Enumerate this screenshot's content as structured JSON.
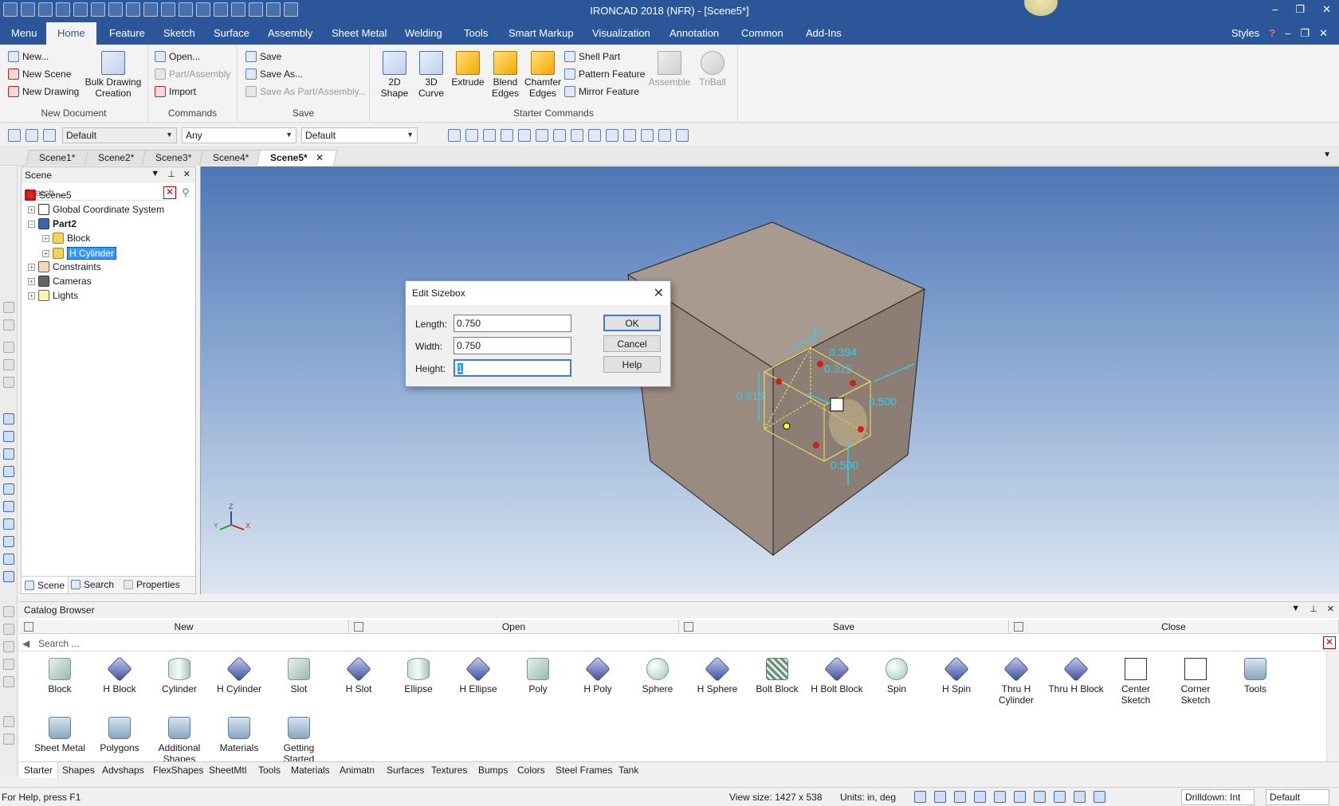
{
  "window": {
    "title": "IRONCAD 2018 (NFR) - [Scene5*]",
    "controls": [
      "–",
      "❐",
      "✕"
    ]
  },
  "menu": {
    "tabs": [
      "Menu",
      "Home",
      "Feature",
      "Sketch",
      "Surface",
      "Assembly",
      "Sheet Metal",
      "Welding",
      "Tools",
      "Smart Markup",
      "Visualization",
      "Annotation",
      "Common",
      "Add-Ins"
    ],
    "active": "Home",
    "styles_label": "Styles",
    "right_controls": [
      "?",
      "–",
      "❐",
      "✕"
    ]
  },
  "ribbon": {
    "new_document": {
      "label": "New Document",
      "new": "New...",
      "new_scene": "New Scene",
      "new_drawing": "New Drawing",
      "bulk_line1": "Bulk Drawing",
      "bulk_line2": "Creation"
    },
    "commands": {
      "label": "Commands",
      "open": "Open...",
      "part_assembly": "Part/Assembly",
      "import": "Import"
    },
    "save": {
      "label": "Save",
      "save": "Save",
      "save_as": "Save As...",
      "save_as_part": "Save As Part/Assembly..."
    },
    "starter": {
      "label": "Starter Commands",
      "shape_2d_l1": "2D",
      "shape_2d_l2": "Shape",
      "curve_3d_l1": "3D",
      "curve_3d_l2": "Curve",
      "extrude": "Extrude",
      "blend_l1": "Blend",
      "blend_l2": "Edges",
      "chamfer_l1": "Chamfer",
      "chamfer_l2": "Edges",
      "shell_part": "Shell Part",
      "pattern_feature": "Pattern Feature",
      "mirror_feature": "Mirror Feature",
      "assemble": "Assemble",
      "triball": "TriBall"
    }
  },
  "toolbar": {
    "style_combo": "Default",
    "filter_combo": "Any",
    "render_combo": "Default"
  },
  "scene_tabs": [
    "Scene1*",
    "Scene2*",
    "Scene3*",
    "Scene4*",
    "Scene5*"
  ],
  "scene_tabs_active": "Scene5*",
  "scene_panel": {
    "title": "Scene",
    "search_placeholder": "Search ...",
    "tree": {
      "root": "Scene5",
      "gcs": "Global Coordinate System",
      "part": "Part2",
      "block": "Block",
      "cylinder": "H Cylinder",
      "constraints": "Constraints",
      "cameras": "Cameras",
      "lights": "Lights"
    },
    "bottom_tabs": [
      "Scene",
      "Search",
      "Properties"
    ]
  },
  "viewport": {
    "dims": {
      "d1": "0.394",
      "d2": "0.315",
      "d3": "0.815",
      "d4": "0.500",
      "d5": "0.500"
    },
    "axes": {
      "x": "X",
      "y": "Y",
      "z": "Z"
    }
  },
  "dialog": {
    "title": "Edit Sizebox",
    "length_label": "Length:",
    "length_value": "0.750",
    "width_label": "Width:",
    "width_value": "0.750",
    "height_label": "Height:",
    "height_value": "1",
    "ok": "OK",
    "cancel": "Cancel",
    "help": "Help"
  },
  "catalog": {
    "title": "Catalog Browser",
    "actions": [
      "New",
      "Open",
      "Save",
      "Close"
    ],
    "search_placeholder": "Search ...",
    "items_row1": [
      {
        "label": "Block",
        "icon": "box"
      },
      {
        "label": "H Block",
        "icon": "neg"
      },
      {
        "label": "Cylinder",
        "icon": "cyl"
      },
      {
        "label": "H Cylinder",
        "icon": "neg"
      },
      {
        "label": "Slot",
        "icon": "box"
      },
      {
        "label": "H Slot",
        "icon": "neg"
      },
      {
        "label": "Ellipse",
        "icon": "cyl"
      },
      {
        "label": "H Ellipse",
        "icon": "neg"
      },
      {
        "label": "Poly",
        "icon": "box"
      },
      {
        "label": "H Poly",
        "icon": "neg"
      },
      {
        "label": "Sphere",
        "icon": "sph"
      },
      {
        "label": "H Sphere",
        "icon": "neg"
      },
      {
        "label": "Bolt Block",
        "icon": "grid"
      },
      {
        "label": "H Bolt Block",
        "icon": "neg"
      },
      {
        "label": "Spin",
        "icon": "sph"
      },
      {
        "label": "H Spin",
        "icon": "neg"
      },
      {
        "label": "Thru H Cylinder",
        "icon": "neg"
      },
      {
        "label": "Thru H Block",
        "icon": "neg"
      },
      {
        "label": "Center Sketch",
        "icon": "sketch"
      },
      {
        "label": "Corner Sketch",
        "icon": "sketch"
      },
      {
        "label": "Tools",
        "icon": "folder"
      }
    ],
    "items_row2": [
      {
        "label": "Sheet Metal",
        "icon": "folder"
      },
      {
        "label": "Polygons",
        "icon": "folder"
      },
      {
        "label": "Additional Shapes",
        "icon": "folder"
      },
      {
        "label": "Materials",
        "icon": "folder"
      },
      {
        "label": "Getting Started",
        "icon": "folder"
      }
    ],
    "tabs": [
      "Starter",
      "Shapes",
      "Advshaps",
      "FlexShapes",
      "SheetMtl",
      "Tools",
      "Materials",
      "Animatn",
      "Surfaces",
      "Textures",
      "Bumps",
      "Colors",
      "Steel Frames",
      "Tank"
    ],
    "active_tab": "Starter"
  },
  "status": {
    "help": "For Help, press F1",
    "view_size": "View size: 1427 x  538",
    "units": "Units: in, deg",
    "drilldown": "Drilldown: Int",
    "default": "Default"
  }
}
